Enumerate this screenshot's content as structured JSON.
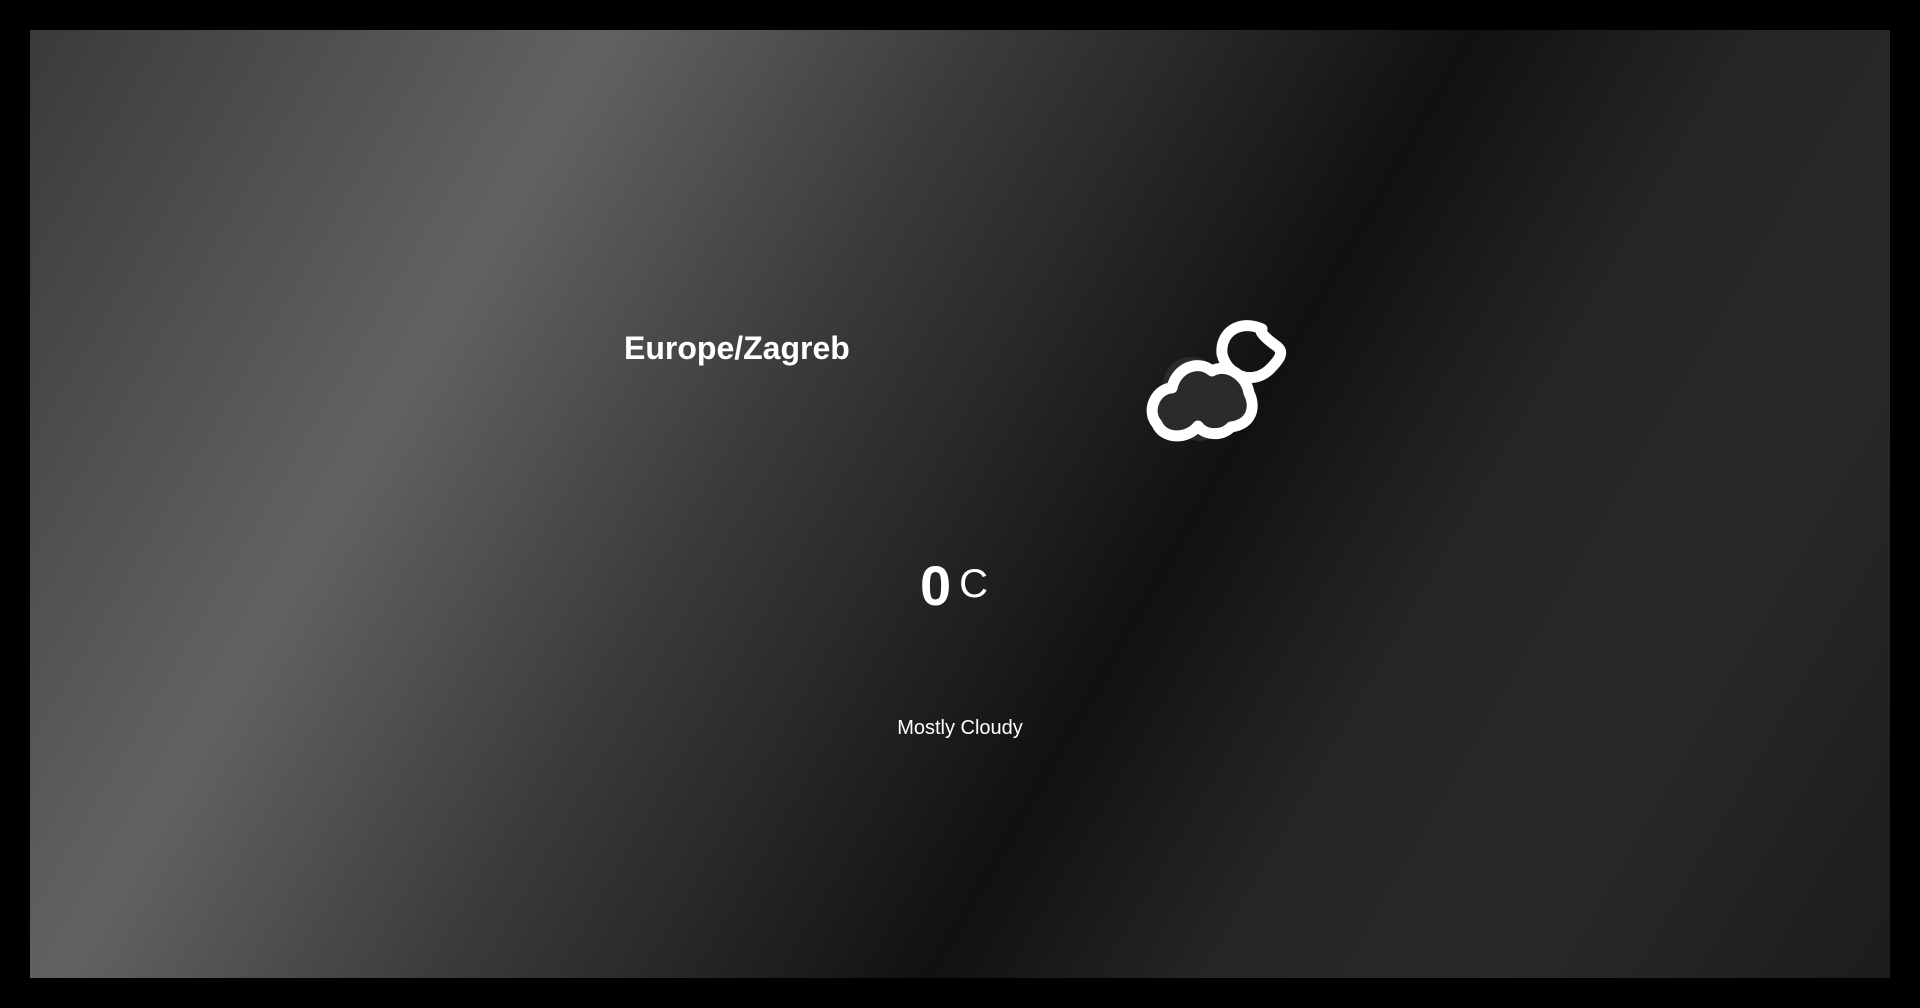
{
  "weather": {
    "location": "Europe/Zagreb",
    "temperature": "0",
    "unit": "C",
    "condition": "Mostly Cloudy",
    "icon": "cloud-moon-icon"
  },
  "colors": {
    "text": "#ffffff",
    "outer_background": "#000000",
    "gradient_light": "#626262",
    "gradient_dark": "#111111"
  }
}
